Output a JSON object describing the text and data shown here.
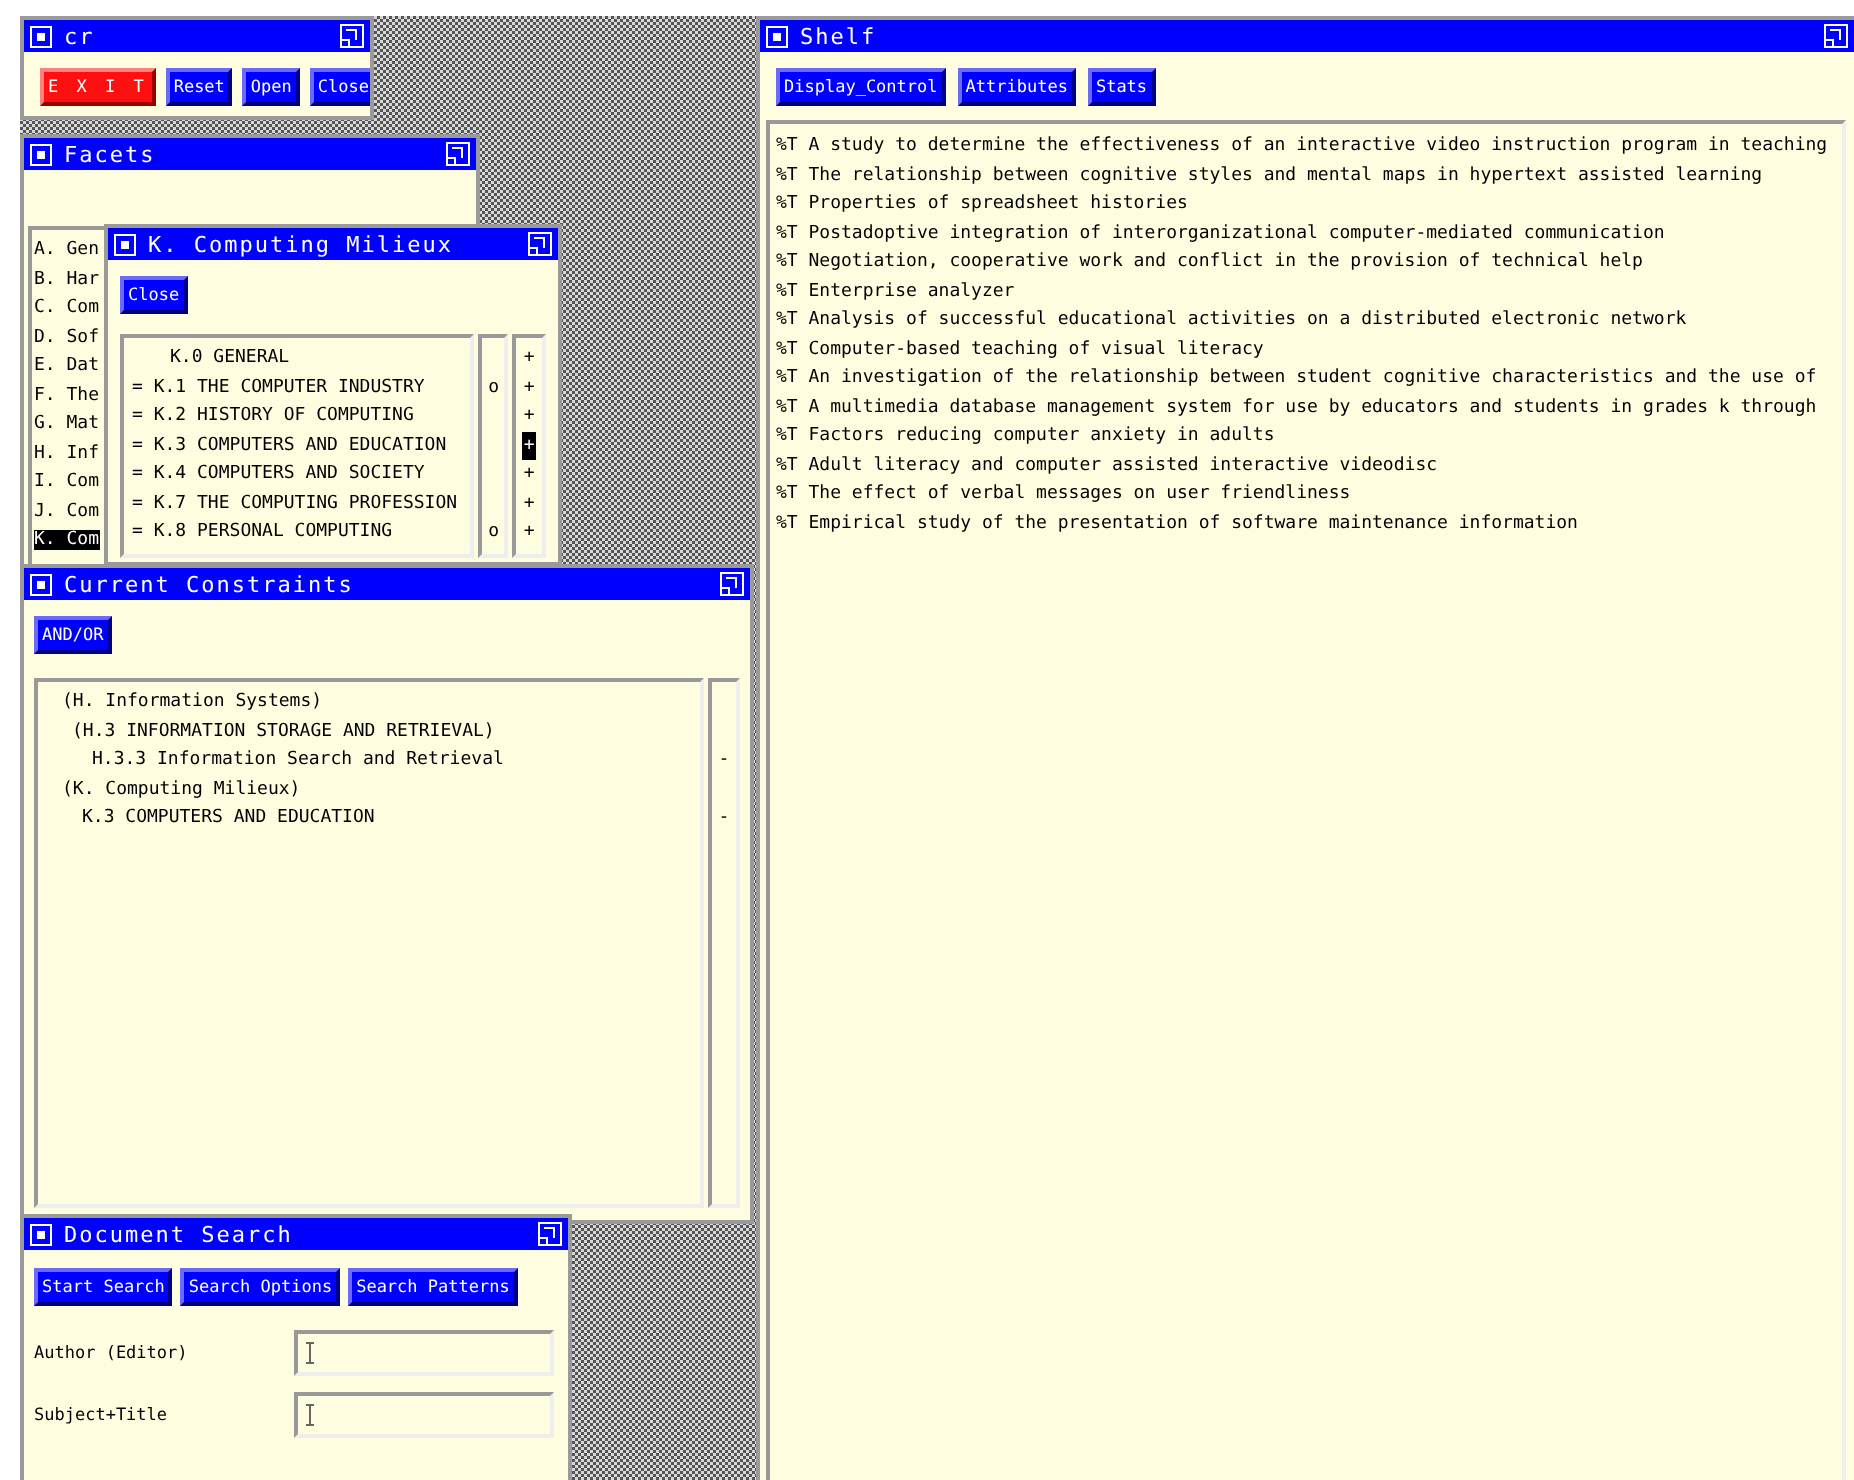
{
  "cr": {
    "title": "cr",
    "buttons": [
      {
        "label": "E X I T",
        "kind": "danger"
      },
      {
        "label": "Reset",
        "kind": "normal"
      },
      {
        "label": "Open",
        "kind": "normal"
      },
      {
        "label": "Close",
        "kind": "normal"
      }
    ]
  },
  "facets": {
    "title": "Facets",
    "items": [
      {
        "label": "A. Gen",
        "selected": false
      },
      {
        "label": "B. Har",
        "selected": false
      },
      {
        "label": "C. Com",
        "selected": false
      },
      {
        "label": "D. Sof",
        "selected": false
      },
      {
        "label": "E. Dat",
        "selected": false
      },
      {
        "label": "F. The",
        "selected": false
      },
      {
        "label": "G. Mat",
        "selected": false
      },
      {
        "label": "H. Inf",
        "selected": false
      },
      {
        "label": "I. Com",
        "selected": false
      },
      {
        "label": "J. Com",
        "selected": false
      },
      {
        "label": "K. Com",
        "selected": true
      }
    ]
  },
  "milieux": {
    "title": "K. Computing Milieux",
    "close_button": "Close",
    "rows": [
      {
        "label": "K.0 GENERAL",
        "flag": "+",
        "flag_selected": false
      },
      {
        "prefix": "=",
        "label": "K.1 THE COMPUTER INDUSTRY",
        "mark": "o",
        "flag": "+",
        "flag_selected": false
      },
      {
        "prefix": "=",
        "label": "K.2 HISTORY OF COMPUTING",
        "flag": "+",
        "flag_selected": false
      },
      {
        "prefix": "=",
        "label": "K.3 COMPUTERS AND EDUCATION",
        "flag": "+",
        "flag_selected": true
      },
      {
        "prefix": "=",
        "label": "K.4 COMPUTERS AND SOCIETY",
        "flag": "+",
        "flag_selected": false
      },
      {
        "prefix": "=",
        "label": "K.7 THE COMPUTING PROFESSION",
        "flag": "+",
        "flag_selected": false
      },
      {
        "prefix": "=",
        "label": "K.8 PERSONAL COMPUTING",
        "mark": "o",
        "flag": "+",
        "flag_selected": false
      }
    ]
  },
  "constraints": {
    "title": "Current Constraints",
    "button": "AND/OR",
    "tree": [
      {
        "label": "(H. Information Systems)",
        "children": [
          {
            "label": "(H.3 INFORMATION STORAGE AND RETRIEVAL)",
            "children": [
              {
                "label": "H.3.3 Information Search and Retrieval",
                "mark": "-"
              }
            ]
          }
        ]
      },
      {
        "label": "(K. Computing Milieux)",
        "children": [
          {
            "label": "K.3 COMPUTERS AND EDUCATION",
            "mark": "-"
          }
        ]
      }
    ]
  },
  "document_search": {
    "title": "Document Search",
    "buttons": [
      "Start Search",
      "Search Options",
      "Search Patterns"
    ],
    "fields": [
      {
        "label": "Author (Editor)"
      },
      {
        "label": "Subject+Title"
      }
    ]
  },
  "shelf": {
    "title": "Shelf",
    "buttons": [
      "Display_Control",
      "Attributes",
      "Stats"
    ],
    "items": [
      "%T A study to determine the effectiveness of an interactive video instruction program in teaching",
      "%T The relationship between cognitive styles and mental maps in hypertext assisted learning",
      "%T Properties of spreadsheet histories",
      "%T Postadoptive integration of interorganizational computer-mediated communication",
      "%T Negotiation, cooperative work and conflict in the provision of technical help",
      "%T Enterprise analyzer",
      "%T Analysis of successful educational activities on a distributed electronic network",
      "%T Computer-based teaching of visual literacy",
      "%T An investigation of the relationship between student cognitive characteristics and the use of",
      "%T A multimedia database management system for use by educators and students in grades k through",
      "%T Factors reducing computer anxiety in adults",
      "%T Adult literacy and computer assisted interactive videodisc",
      "%T The effect of verbal messages on user friendliness",
      "%T Empirical study of the presentation of software maintenance information"
    ]
  }
}
